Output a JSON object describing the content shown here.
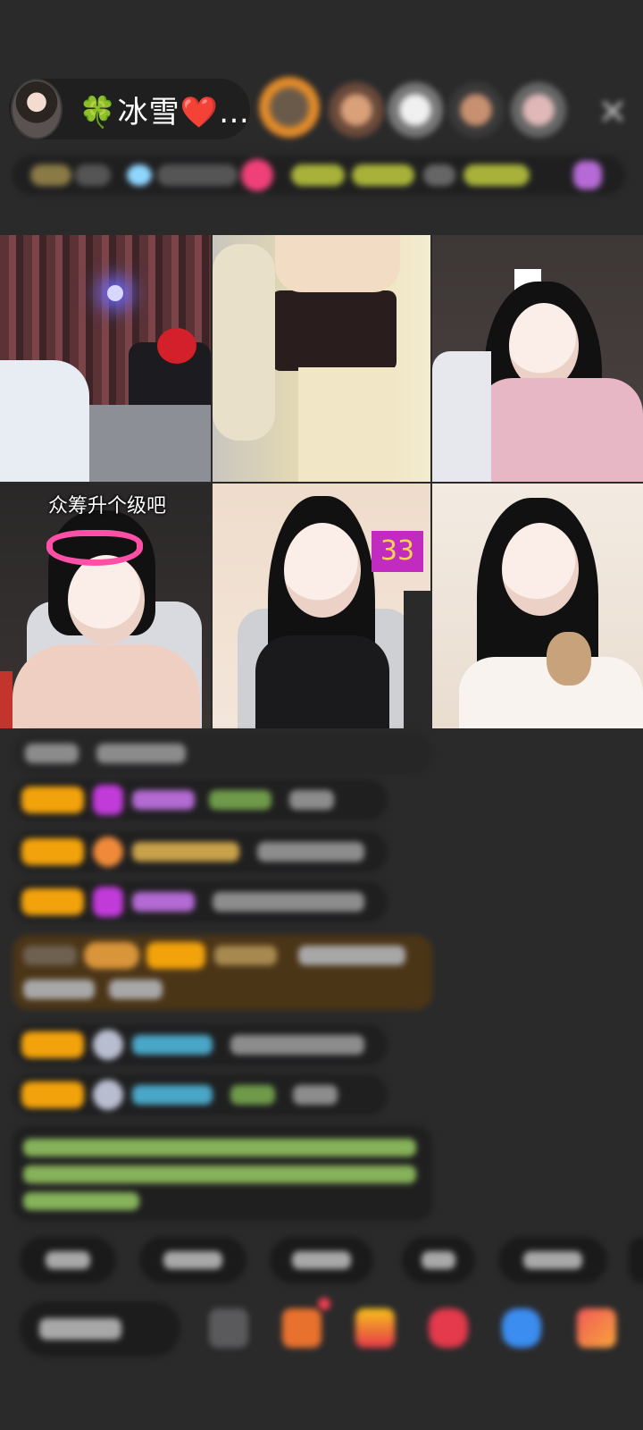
{
  "header": {
    "host_name": "🍀冰雪❤️…",
    "close_icon": "close-icon"
  },
  "video_grid": {
    "tile_4_caption": "众筹升个级吧",
    "tile_5_badge": "33"
  },
  "colors": {
    "background": "#2a2a2b",
    "pill": "#1f1f20",
    "level_badge": "#f2a20b",
    "purple_badge": "#c22bbf",
    "badge_text": "#ffd84a",
    "highlight_message": "#4b3517"
  }
}
